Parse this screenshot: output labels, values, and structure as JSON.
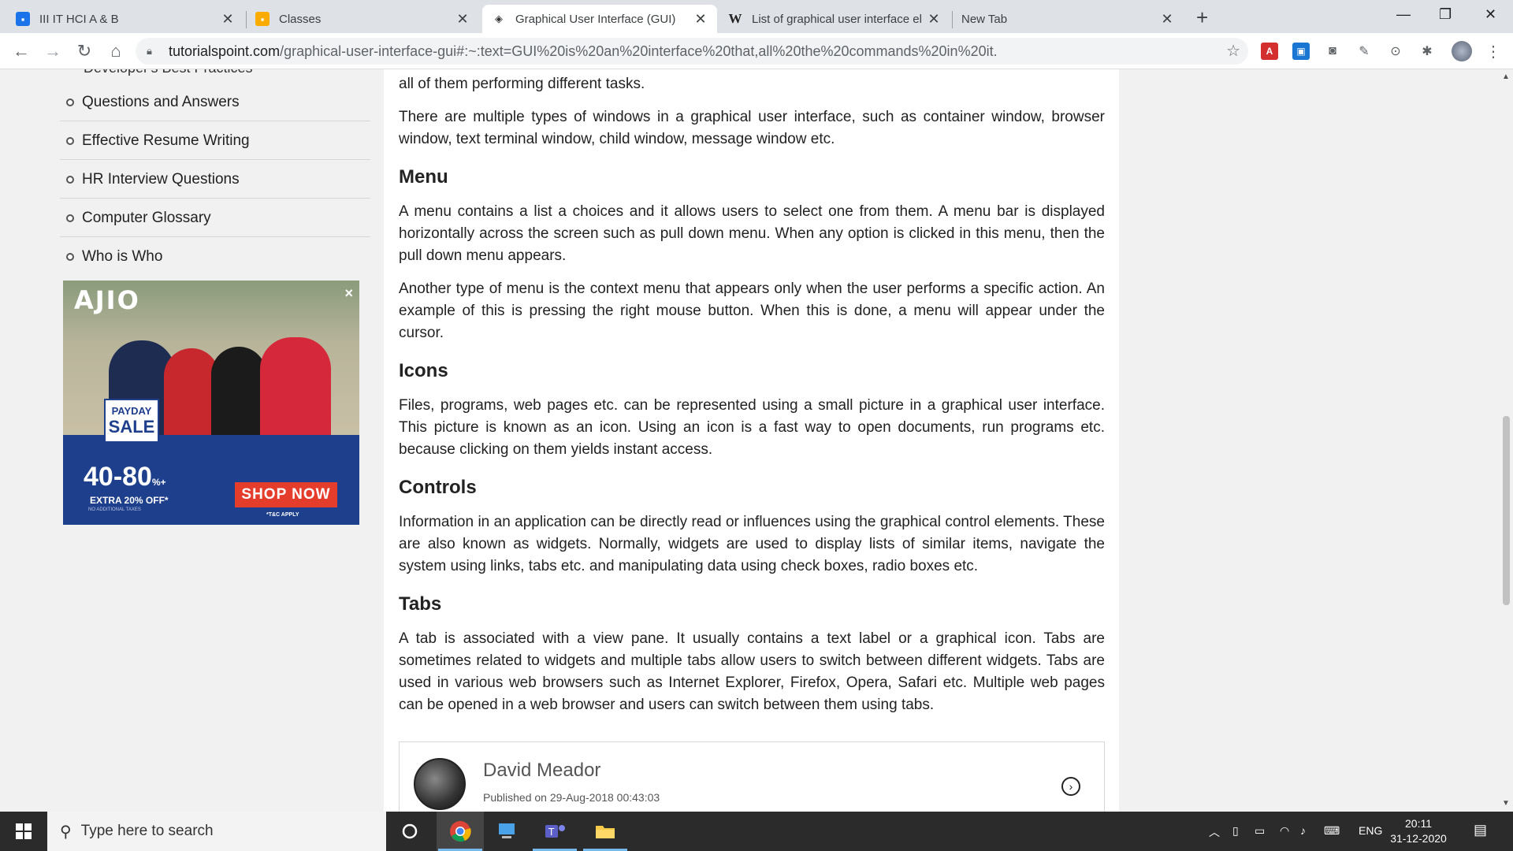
{
  "browser": {
    "tabs": [
      {
        "title": "III IT HCI A & B",
        "active": false
      },
      {
        "title": "Classes",
        "active": false
      },
      {
        "title": "Graphical User Interface (GUI)",
        "active": true
      },
      {
        "title": "List of graphical user interface el",
        "active": false
      },
      {
        "title": "New Tab",
        "active": false
      }
    ],
    "url_host": "tutorialspoint.com",
    "url_path": "/graphical-user-interface-gui#:~:text=GUI%20is%20an%20interface%20that,all%20the%20commands%20in%20it."
  },
  "sidebar": {
    "cut_item": "Developer's Best Practices",
    "items": [
      "Questions and Answers",
      "Effective Resume Writing",
      "HR Interview Questions",
      "Computer Glossary",
      "Who is Who"
    ]
  },
  "ad": {
    "brand": "AJIO",
    "close": "×",
    "badge_line1": "PAYDAY",
    "badge_line2": "SALE",
    "discount": "40-80",
    "discount_suffix": "%+",
    "extra": "EXTRA 20% OFF*",
    "tax_note": "NO ADDITIONAL TAXES",
    "cta": "SHOP NOW",
    "tc": "*T&C APPLY"
  },
  "article": {
    "p0": "all of them performing different tasks.",
    "p1": "There are multiple types of windows in a graphical user interface, such as container window, browser window, text terminal window, child window, message window etc.",
    "h_menu": "Menu",
    "p_menu1": "A menu contains a list a choices and it allows users to select one from them. A menu bar is displayed horizontally across the screen such as pull down menu. When any option is clicked in this menu, then the pull down menu appears.",
    "p_menu2": "Another type of menu is the context menu that appears only when the user performs a specific action. An example of this is pressing the right mouse button. When this is done, a menu will appear under the cursor.",
    "h_icons": "Icons",
    "p_icons": "Files, programs, web pages etc. can be represented using a small picture in a graphical user interface. This picture is known as an icon. Using an icon is a fast way to open documents, run programs etc. because clicking on them yields instant access.",
    "h_controls": "Controls",
    "p_controls": "Information in an application can be directly read or influences using the graphical control elements. These are also known as widgets. Normally, widgets are used to display lists of similar items, navigate the system using links, tabs etc. and manipulating data using check boxes, radio boxes etc.",
    "h_tabs": "Tabs",
    "p_tabs": "A tab is associated with a view pane. It usually contains a text label or a graphical icon. Tabs are sometimes related to widgets and multiple tabs allow users to switch between different widgets. Tabs are used in various web browsers such as Internet Explorer, Firefox, Opera, Safari etc. Multiple web pages can be opened in a web browser and users can switch between them using tabs."
  },
  "author": {
    "name": "David Meador",
    "published": "Published on 29-Aug-2018 00:43:03"
  },
  "taskbar": {
    "search_placeholder": "Type here to search",
    "lang": "ENG",
    "time": "20:11",
    "date": "31-12-2020"
  },
  "colors": {
    "accent_link": "#1a73e8",
    "ad_blue": "#1e3f8c",
    "ad_red": "#e53d2b"
  }
}
